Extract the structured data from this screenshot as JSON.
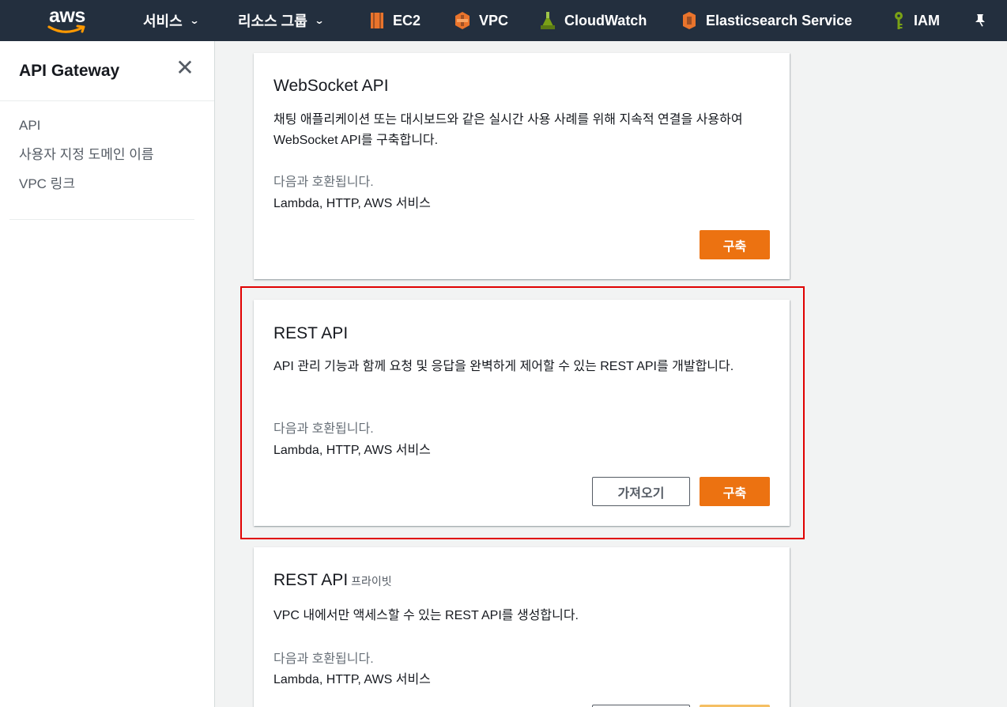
{
  "topnav": {
    "logo_text": "aws",
    "items": [
      {
        "label": "서비스",
        "has_chevron": true
      },
      {
        "label": "리소스 그룹",
        "has_chevron": true
      },
      {
        "label": "EC2",
        "icon": "ec2-icon",
        "color": "#e9742c"
      },
      {
        "label": "VPC",
        "icon": "vpc-icon",
        "color": "#e9742c"
      },
      {
        "label": "CloudWatch",
        "icon": "cloudwatch-icon",
        "color": "#7aa116"
      },
      {
        "label": "Elasticsearch Service",
        "icon": "elasticsearch-icon",
        "color": "#e9742c"
      },
      {
        "label": "IAM",
        "icon": "iam-key-icon",
        "color": "#7aa116"
      }
    ],
    "pin_icon": "pin-icon",
    "chevron": "⌄"
  },
  "sidebar": {
    "title": "API Gateway",
    "close_glyph": "✕",
    "links": [
      "API",
      "사용자 지정 도메인 이름",
      "VPC 링크"
    ]
  },
  "cards": [
    {
      "title": "WebSocket API",
      "description": "채팅 애플리케이션 또는 대시보드와 같은 실시간 사용 사례를 위해 지속적 연결을 사용하여 WebSocket API를 구축합니다.",
      "compat_label": "다음과 호환됩니다.",
      "compat_value": "Lambda, HTTP, AWS 서비스",
      "build_label": "구축"
    },
    {
      "title": "REST API",
      "description": "API 관리 기능과 함께 요청 및 응답을 완벽하게 제어할 수 있는 REST API를 개발합니다.",
      "compat_label": "다음과 호환됩니다.",
      "compat_value": "Lambda, HTTP, AWS 서비스",
      "import_label": "가져오기",
      "build_label": "구축"
    },
    {
      "title": "REST API",
      "subtitle": "프라이빗",
      "description": "VPC 내에서만 액세스할 수 있는 REST API를 생성합니다.",
      "compat_label": "다음과 호환됩니다.",
      "compat_value": "Lambda, HTTP, AWS 서비스"
    }
  ],
  "colors": {
    "nav_bg": "#232f3e",
    "primary": "#ec7211",
    "highlight": "#e00000",
    "page_bg": "#f2f3f3"
  }
}
